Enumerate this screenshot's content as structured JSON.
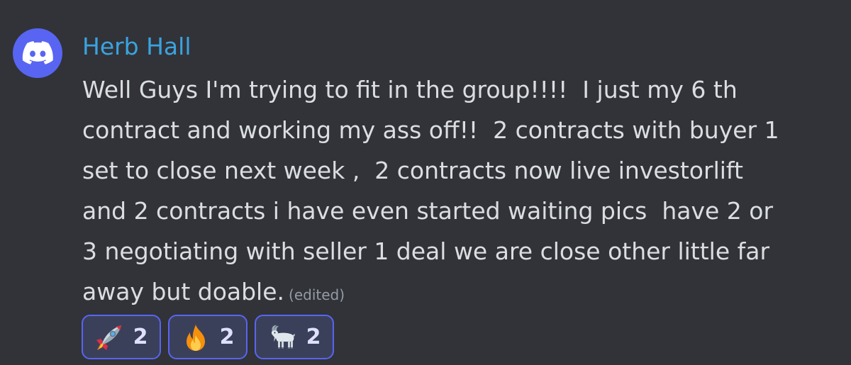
{
  "message": {
    "author": "Herb Hall",
    "author_color": "#3BA3E0",
    "avatar_icon": "discord-logo-icon",
    "avatar_color": "#5865F2",
    "lines": [
      "Well Guys I'm trying to fit in the group!!!!  I just my 6 th",
      "contract and working my ass off!!  2 contracts with buyer 1",
      "set to close next week ,  2 contracts now live investorlift",
      "and 2 contracts i have even started waiting pics  have 2 or",
      "3 negotiating with seller 1 deal we are close other little far",
      "away but doable."
    ],
    "edited_label": "(edited)"
  },
  "reactions": [
    {
      "icon": "rocket-icon",
      "count": "2"
    },
    {
      "icon": "fire-icon",
      "count": "2"
    },
    {
      "icon": "goat-icon",
      "count": "2"
    }
  ]
}
